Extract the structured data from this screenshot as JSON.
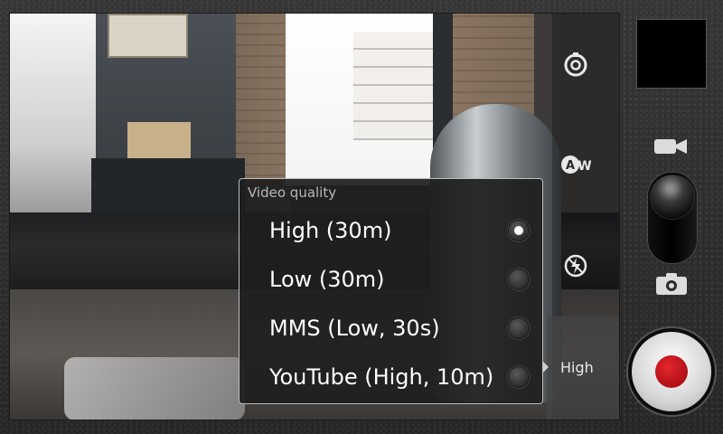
{
  "popup": {
    "title": "Video quality",
    "options": [
      {
        "label": "High (30m)",
        "selected": true
      },
      {
        "label": "Low (30m)",
        "selected": false
      },
      {
        "label": "MMS (Low, 30s)",
        "selected": false
      },
      {
        "label": "YouTube (High, 10m)",
        "selected": false
      }
    ]
  },
  "settings": {
    "quality_value": "High",
    "items": [
      {
        "name": "camera-settings-icon"
      },
      {
        "name": "white-balance-auto-icon",
        "text": "AW"
      },
      {
        "name": "flash-off-icon"
      }
    ]
  },
  "right_panel": {
    "mode": "video",
    "thumbnail": "empty"
  },
  "colors": {
    "record": "#c4161d",
    "popup_border": "#bdbdbd",
    "popup_bg": "#1e1e1e"
  }
}
